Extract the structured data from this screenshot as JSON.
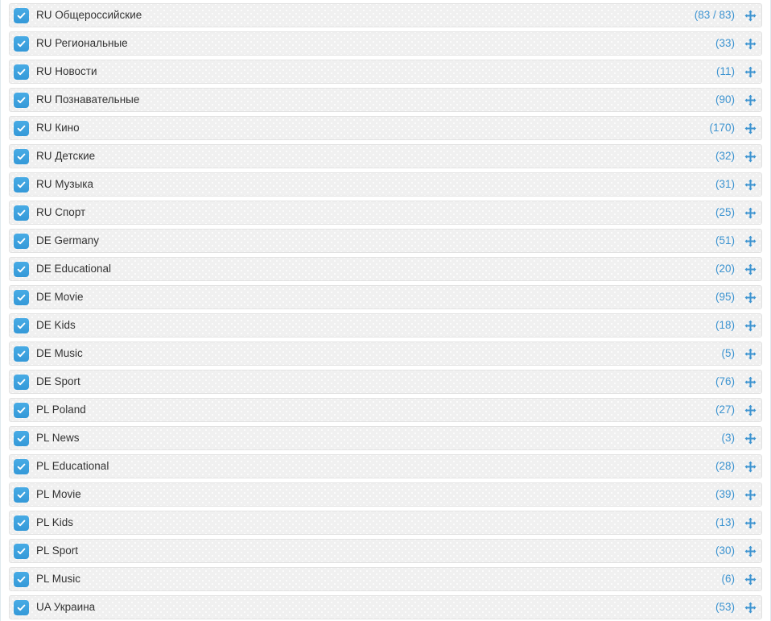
{
  "panel": {
    "name": "channel-group-list",
    "accent_color": "#3d94d1",
    "checkbox_color": "#3ca3e0",
    "row_background": "#f0f0f0",
    "row_border_color": "#e2e2e2",
    "label_color": "#333333",
    "panel_border_color": "#dfe9ee"
  },
  "icons": {
    "checkbox_checked": "check-icon",
    "drag_handle": "move-arrows-icon"
  },
  "rows": [
    {
      "label": "RU Общероссийские",
      "count": "(83 / 83)",
      "checked": true
    },
    {
      "label": "RU Региональные",
      "count": "(33)",
      "checked": true
    },
    {
      "label": "RU Новости",
      "count": "(11)",
      "checked": true
    },
    {
      "label": "RU Познавательные",
      "count": "(90)",
      "checked": true
    },
    {
      "label": "RU Кино",
      "count": "(170)",
      "checked": true
    },
    {
      "label": "RU Детские",
      "count": "(32)",
      "checked": true
    },
    {
      "label": "RU Музыка",
      "count": "(31)",
      "checked": true
    },
    {
      "label": "RU Спорт",
      "count": "(25)",
      "checked": true
    },
    {
      "label": "DE Germany",
      "count": "(51)",
      "checked": true
    },
    {
      "label": "DE Educational",
      "count": "(20)",
      "checked": true
    },
    {
      "label": "DE Movie",
      "count": "(95)",
      "checked": true
    },
    {
      "label": "DE Kids",
      "count": "(18)",
      "checked": true
    },
    {
      "label": "DE Music",
      "count": "(5)",
      "checked": true
    },
    {
      "label": "DE Sport",
      "count": "(76)",
      "checked": true
    },
    {
      "label": "PL Poland",
      "count": "(27)",
      "checked": true
    },
    {
      "label": "PL News",
      "count": "(3)",
      "checked": true
    },
    {
      "label": "PL Educational",
      "count": "(28)",
      "checked": true
    },
    {
      "label": "PL Movie",
      "count": "(39)",
      "checked": true
    },
    {
      "label": "PL Kids",
      "count": "(13)",
      "checked": true
    },
    {
      "label": "PL Sport",
      "count": "(30)",
      "checked": true
    },
    {
      "label": "PL Music",
      "count": "(6)",
      "checked": true
    },
    {
      "label": "UA Украина",
      "count": "(53)",
      "checked": true
    }
  ]
}
